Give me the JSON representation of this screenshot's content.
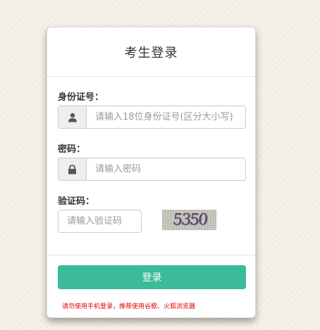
{
  "login_card": {
    "title": "考生登录",
    "id_field": {
      "label": "身份证号：",
      "placeholder": "请输入18位身份证号(区分大小写)",
      "icon": "user-icon"
    },
    "password_field": {
      "label": "密码：",
      "placeholder": "请输入密码",
      "icon": "lock-icon"
    },
    "captcha_field": {
      "label": "验证码：",
      "placeholder": "请输入验证码",
      "captcha_text": "5350"
    },
    "login_button": "登录",
    "notice": "请勿使用手机登录，推荐使用谷歌、火狐浏览器"
  },
  "colors": {
    "accent": "#3bbb97",
    "notice": "#e00000",
    "background": "#f6f3ea"
  }
}
